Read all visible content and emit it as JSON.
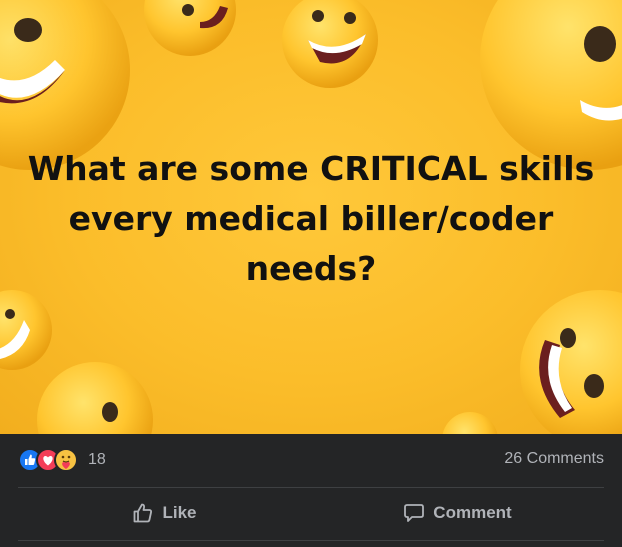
{
  "post": {
    "image_text": "What are some CRITICAL skills every medical biller/coder needs?",
    "image_background": "#fbbd2a"
  },
  "stats": {
    "reactions": [
      "like-icon",
      "love-icon",
      "care-icon"
    ],
    "reaction_count": "18",
    "comments_count": "26 Comments"
  },
  "actions": {
    "like_label": "Like",
    "comment_label": "Comment"
  },
  "colors": {
    "footer_bg": "#242526",
    "muted_text": "#b0b3b8",
    "like_blue": "#1877f2",
    "love_red": "#f33e58"
  }
}
